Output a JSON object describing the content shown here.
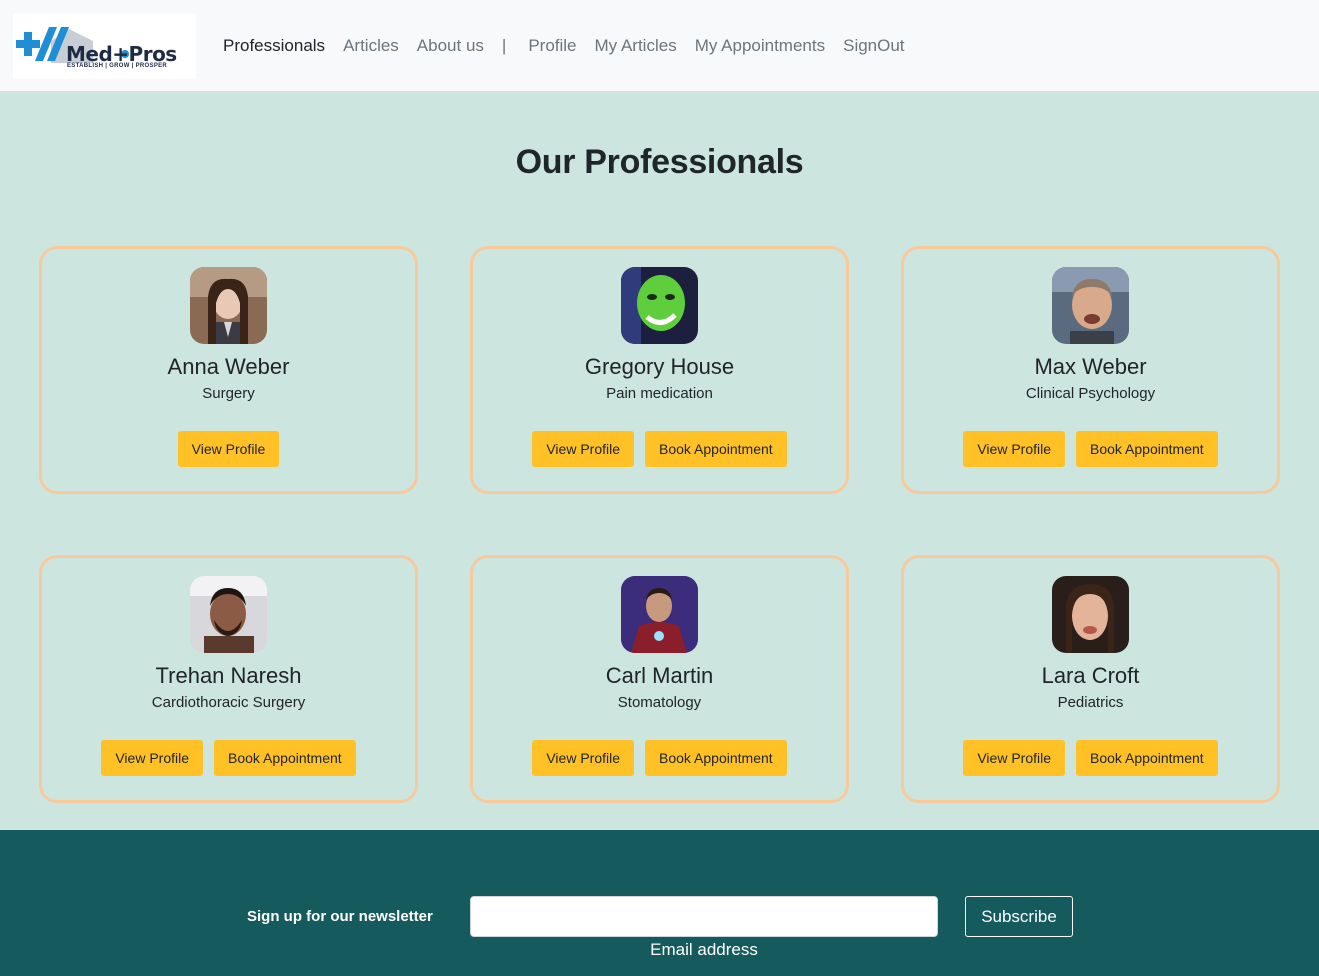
{
  "brand": {
    "logo_text": "Med+Pros",
    "tagline": "ESTABLISH | GROW | PROSPER",
    "colors": {
      "primary": "#1f8ed4",
      "dark": "#1f2a44"
    }
  },
  "nav": {
    "links": [
      {
        "label": "Professionals",
        "active": true
      },
      {
        "label": "Articles"
      },
      {
        "label": "About us"
      }
    ],
    "separator": "|",
    "user_links": [
      {
        "label": "Profile"
      },
      {
        "label": "My Articles"
      },
      {
        "label": "My Appointments"
      },
      {
        "label": "SignOut"
      }
    ]
  },
  "main": {
    "title": "Our Professionals",
    "colors": {
      "background": "#cce5df",
      "card_border": "#f8c99b",
      "button": "#ffc125"
    },
    "professionals": [
      {
        "name": "Anna Weber",
        "specialty": "Surgery",
        "view_label": "View Profile",
        "book_label": ""
      },
      {
        "name": "Gregory House",
        "specialty": "Pain medication",
        "view_label": "View Profile",
        "book_label": "Book Appointment"
      },
      {
        "name": "Max Weber",
        "specialty": "Clinical Psychology",
        "view_label": "View Profile",
        "book_label": "Book Appointment"
      },
      {
        "name": "Trehan Naresh",
        "specialty": "Cardiothoracic Surgery",
        "view_label": "View Profile",
        "book_label": "Book Appointment"
      },
      {
        "name": "Carl Martin",
        "specialty": "Stomatology",
        "view_label": "View Profile",
        "book_label": "Book Appointment"
      },
      {
        "name": "Lara Croft",
        "specialty": "Pediatrics",
        "view_label": "View Profile",
        "book_label": "Book Appointment"
      }
    ]
  },
  "footer": {
    "newsletter_label": "Sign up for our newsletter",
    "email_value": "",
    "email_caption": "Email address",
    "subscribe_label": "Subscribe",
    "colors": {
      "background": "#155a5c"
    }
  }
}
